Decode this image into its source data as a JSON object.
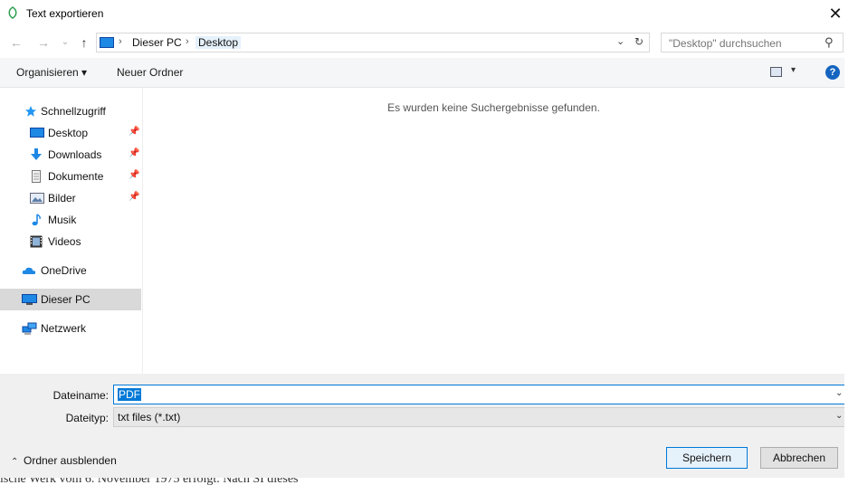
{
  "window": {
    "title": "Text exportieren",
    "close_glyph": "✕"
  },
  "nav": {
    "back_glyph": "←",
    "forward_glyph": "→",
    "recent_glyph": "⌄",
    "up_glyph": "↑",
    "breadcrumbs": [
      "Dieser PC",
      "Desktop"
    ],
    "crumb_sep": "›",
    "address_dropdown_glyph": "⌄",
    "refresh_glyph": "↻",
    "search_placeholder": "\"Desktop\" durchsuchen",
    "search_glyph": "⚲"
  },
  "toolbar": {
    "organize": "Organisieren ▾",
    "new_folder": "Neuer Ordner",
    "view_dropdown_glyph": "▾",
    "help_glyph": "?"
  },
  "sidebar": {
    "items": [
      {
        "label": "Schnellzugriff",
        "icon": "star-icon",
        "pinned": false
      },
      {
        "label": "Desktop",
        "icon": "desktop-icon",
        "pinned": true
      },
      {
        "label": "Downloads",
        "icon": "download-icon",
        "pinned": true
      },
      {
        "label": "Dokumente",
        "icon": "document-icon",
        "pinned": true
      },
      {
        "label": "Bilder",
        "icon": "picture-icon",
        "pinned": true
      },
      {
        "label": "Musik",
        "icon": "music-icon",
        "pinned": false
      },
      {
        "label": "Videos",
        "icon": "video-icon",
        "pinned": false
      },
      {
        "label": "OneDrive",
        "icon": "cloud-icon",
        "pinned": false
      },
      {
        "label": "Dieser PC",
        "icon": "computer-icon",
        "pinned": false,
        "selected": true
      },
      {
        "label": "Netzwerk",
        "icon": "network-icon",
        "pinned": false
      }
    ],
    "pin_glyph": "📌"
  },
  "main": {
    "empty_message": "Es wurden keine Suchergebnisse gefunden."
  },
  "form": {
    "filename_label": "Dateiname:",
    "filename_value": "PDF",
    "filetype_label": "Dateityp:",
    "filetype_value": "txt files (*.txt)",
    "dropdown_glyph": "⌄",
    "hide_folders": "Ordner ausblenden",
    "hide_folders_glyph": "⌃",
    "save": "Speichern",
    "cancel": "Abbrechen"
  },
  "background": {
    "bottom_text": "ische Werk vom 6. November 1975 erfolgt. Nach SI dieses"
  },
  "colors": {
    "accent": "#0078d7",
    "selected_bg": "#d9d9d9",
    "toolbar_bg": "#f5f6f7",
    "form_bg": "#f0f0f0"
  }
}
